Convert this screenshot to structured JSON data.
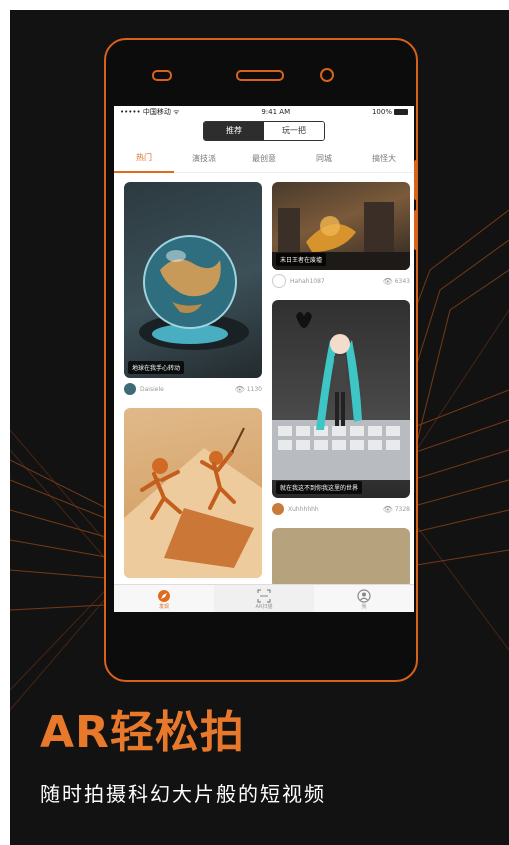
{
  "status_bar": {
    "carrier": "••••• 中国移动 ᯤ",
    "time": "9:41 AM",
    "battery": "100%"
  },
  "segment": {
    "items": [
      "推荐",
      "玩一把"
    ],
    "active": 0
  },
  "tabs": {
    "items": [
      "热门",
      "演技派",
      "最创意",
      "同城",
      "搞怪大"
    ],
    "active": 0
  },
  "feed": {
    "left": [
      {
        "caption": "地球在我手心转动",
        "user": "Daisiele",
        "views": "1130"
      },
      {
        "caption": "",
        "user": "",
        "views": ""
      }
    ],
    "right": [
      {
        "caption": "末日王者在废墟",
        "user": "Hahah1087",
        "views": "6343"
      },
      {
        "caption": "就在我这不到你我这里的世界",
        "user": "Xuhhhhhh",
        "views": "7328"
      }
    ]
  },
  "bottom_nav": {
    "items": [
      "发现",
      "AR扫描",
      "我"
    ],
    "active": 0
  },
  "promo": {
    "headline": "AR轻松拍",
    "subline": "随时拍摄科幻大片般的短视频"
  },
  "colors": {
    "accent": "#e06b1f",
    "frame": "#d9621b",
    "background": "#121212"
  }
}
